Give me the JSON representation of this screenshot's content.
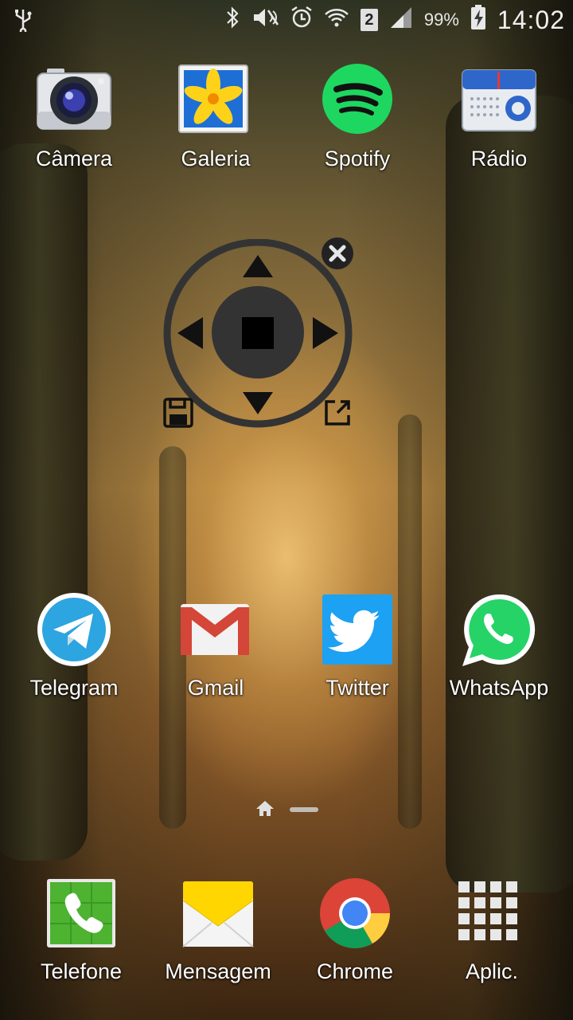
{
  "status_bar": {
    "battery_percent": "99%",
    "time": "14:02",
    "sim_slot": "2",
    "icons": [
      "usb-icon",
      "bluetooth-icon",
      "mute-icon",
      "alarm-icon",
      "wifi-icon",
      "sim-icon",
      "signal-icon",
      "battery-charging-icon"
    ]
  },
  "home_apps_top": [
    {
      "label": "Câmera",
      "icon": "camera-icon"
    },
    {
      "label": "Galeria",
      "icon": "gallery-icon"
    },
    {
      "label": "Spotify",
      "icon": "spotify-icon"
    },
    {
      "label": "Rádio",
      "icon": "radio-icon"
    }
  ],
  "home_apps_mid": [
    {
      "label": "Telegram",
      "icon": "telegram-icon"
    },
    {
      "label": "Gmail",
      "icon": "gmail-icon"
    },
    {
      "label": "Twitter",
      "icon": "twitter-icon"
    },
    {
      "label": "WhatsApp",
      "icon": "whatsapp-icon"
    }
  ],
  "dock_apps": [
    {
      "label": "Telefone",
      "icon": "phone-icon"
    },
    {
      "label": "Mensagem",
      "icon": "message-icon"
    },
    {
      "label": "Chrome",
      "icon": "chrome-icon"
    },
    {
      "label": "Aplic.",
      "icon": "apps-grid-icon"
    }
  ],
  "joystick": {
    "controls": [
      "up-arrow",
      "down-arrow",
      "left-arrow",
      "right-arrow",
      "stop",
      "close",
      "save",
      "open-external"
    ]
  },
  "colors": {
    "spotify": "#1ed760",
    "twitter": "#1da1f2",
    "whatsapp": "#25d366",
    "telegram": "#2ca5e0",
    "gmail_red": "#d44638",
    "joystick": "#333333"
  }
}
